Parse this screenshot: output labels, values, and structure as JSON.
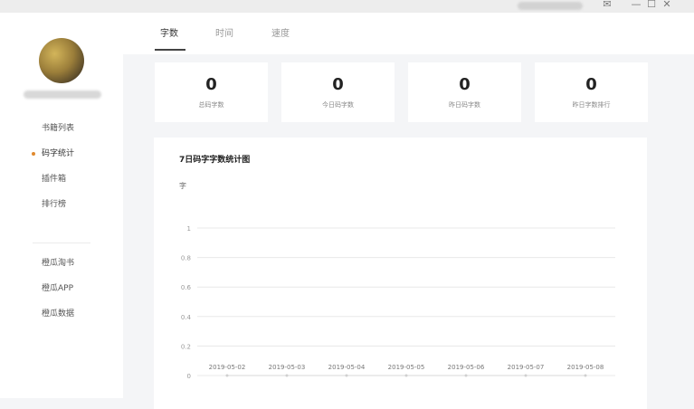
{
  "window": {
    "controls": {
      "mail": "✉",
      "minimize": "—",
      "maximize": "☐",
      "close": "✕"
    }
  },
  "sidebar": {
    "items": [
      {
        "label": "书籍列表",
        "active": false
      },
      {
        "label": "码字统计",
        "active": true
      },
      {
        "label": "插件箱",
        "active": false
      },
      {
        "label": "排行榜",
        "active": false
      }
    ],
    "links": [
      {
        "label": "橙瓜淘书"
      },
      {
        "label": "橙瓜APP"
      },
      {
        "label": "橙瓜数据"
      }
    ]
  },
  "tabs": [
    {
      "label": "字数",
      "active": true
    },
    {
      "label": "时间",
      "active": false
    },
    {
      "label": "速度",
      "active": false
    }
  ],
  "stats": [
    {
      "value": "0",
      "label": "总码字数"
    },
    {
      "value": "0",
      "label": "今日码字数"
    },
    {
      "value": "0",
      "label": "昨日码字数"
    },
    {
      "value": "0",
      "label": "昨日字数排行"
    }
  ],
  "chart_data": {
    "type": "line",
    "title": "7日码字字数统计图",
    "ylabel": "字",
    "xlabel": "",
    "categories": [
      "2019-05-02",
      "2019-05-03",
      "2019-05-04",
      "2019-05-05",
      "2019-05-06",
      "2019-05-07",
      "2019-05-08"
    ],
    "series": [
      {
        "values": [
          0,
          0,
          0,
          0,
          0,
          0,
          0
        ]
      }
    ],
    "yticks": [
      "0",
      "0.2",
      "0.4",
      "0.6",
      "0.8",
      "1"
    ],
    "ylim": [
      0,
      1
    ],
    "grid": true
  },
  "colors": {
    "accent": "#e08a2e",
    "grid": "#e8e8e8"
  }
}
